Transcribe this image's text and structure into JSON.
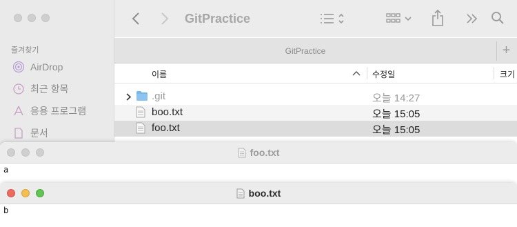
{
  "finder": {
    "title": "GitPractice",
    "tab_title": "GitPractice",
    "tab_add": "+",
    "sidebar": {
      "heading": "즐겨찾기",
      "items": [
        {
          "label": "AirDrop",
          "icon": "airdrop-icon"
        },
        {
          "label": "최근 항목",
          "icon": "clock-icon"
        },
        {
          "label": "응용 프로그램",
          "icon": "applications-icon"
        },
        {
          "label": "문서",
          "icon": "document-icon"
        }
      ]
    },
    "columns": {
      "name": "이름",
      "date": "수정일",
      "size": "크기"
    },
    "files": [
      {
        "name": ".git",
        "date": "오늘 14:27",
        "type": "folder"
      },
      {
        "name": "boo.txt",
        "date": "오늘 15:05",
        "type": "text"
      },
      {
        "name": "foo.txt",
        "date": "오늘 15:05",
        "type": "text"
      }
    ]
  },
  "foo_window": {
    "title": "foo.txt",
    "content": "a"
  },
  "boo_window": {
    "title": "boo.txt",
    "content": "b"
  },
  "colors": {
    "close": "#ed6a5e",
    "minimize": "#f5bf4f",
    "zoom": "#61c554",
    "folder": "#79b7e8"
  }
}
